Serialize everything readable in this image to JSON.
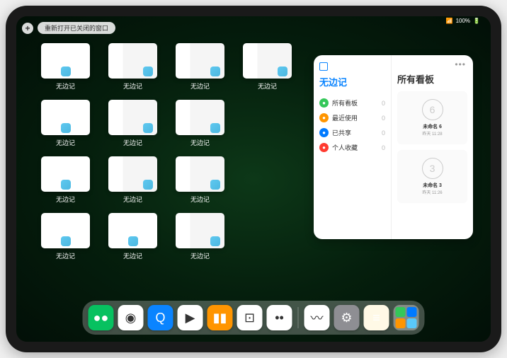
{
  "status": {
    "signal": "•••",
    "battery": "100%"
  },
  "topbar": {
    "plus": "+",
    "reopen_label": "重新打开已关闭的窗口"
  },
  "windows": [
    {
      "label": "无边记",
      "type": "blank"
    },
    {
      "label": "无边记",
      "type": "content"
    },
    {
      "label": "无边记",
      "type": "content"
    },
    {
      "label": "无边记",
      "type": "content"
    },
    {
      "label": "无边记",
      "type": "blank"
    },
    {
      "label": "无边记",
      "type": "content"
    },
    {
      "label": "无边记",
      "type": "content"
    },
    {
      "label": "无边记",
      "type": "blank"
    },
    {
      "label": "无边记",
      "type": "content"
    },
    {
      "label": "无边记",
      "type": "content"
    },
    {
      "label": "无边记",
      "type": "blank"
    },
    {
      "label": "无边记",
      "type": "blank"
    },
    {
      "label": "无边记",
      "type": "content"
    }
  ],
  "panel": {
    "left_title": "无边记",
    "items": [
      {
        "label": "所有看板",
        "count": "0",
        "color": "#34c759"
      },
      {
        "label": "最近使用",
        "count": "0",
        "color": "#ff9500"
      },
      {
        "label": "已共享",
        "count": "0",
        "color": "#007aff"
      },
      {
        "label": "个人收藏",
        "count": "0",
        "color": "#ff3b30"
      }
    ],
    "right_title": "所有看板",
    "boards": [
      {
        "drawing": "6",
        "name": "未命名 6",
        "date": "昨天 11:28"
      },
      {
        "drawing": "3",
        "name": "未命名 3",
        "date": "昨天 11:26"
      }
    ]
  },
  "dock": [
    {
      "name": "wechat",
      "bg": "#07c160",
      "glyph": "●●"
    },
    {
      "name": "quark",
      "bg": "#ffffff",
      "glyph": "◉"
    },
    {
      "name": "quark-hd",
      "bg": "#0a84ff",
      "glyph": "Q"
    },
    {
      "name": "play",
      "bg": "#ffffff",
      "glyph": "▶"
    },
    {
      "name": "books",
      "bg": "#ff9500",
      "glyph": "▮▮"
    },
    {
      "name": "dice",
      "bg": "#ffffff",
      "glyph": "⊡"
    },
    {
      "name": "dots",
      "bg": "#ffffff",
      "glyph": "••"
    },
    {
      "name": "freeform",
      "bg": "#ffffff",
      "glyph": "〰"
    },
    {
      "name": "settings",
      "bg": "#8e8e93",
      "glyph": "⚙"
    },
    {
      "name": "notes",
      "bg": "#fff9e6",
      "glyph": "≡"
    }
  ]
}
